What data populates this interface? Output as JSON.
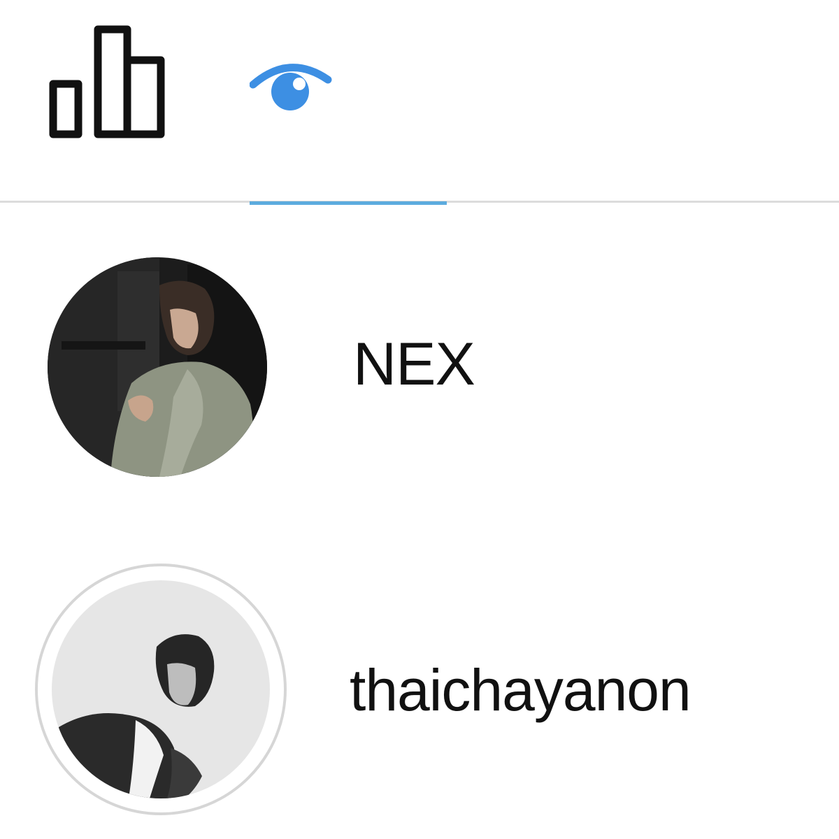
{
  "tabs": [
    {
      "icon": "bar-chart-icon",
      "active": false
    },
    {
      "icon": "eye-icon",
      "active": true
    }
  ],
  "colors": {
    "accent": "#5cabde",
    "eye_icon": "#3d8fe3",
    "divider": "#dcdcdc",
    "text": "#111111"
  },
  "viewers": [
    {
      "username": "NEX"
    },
    {
      "username": "thaichayanon"
    }
  ]
}
